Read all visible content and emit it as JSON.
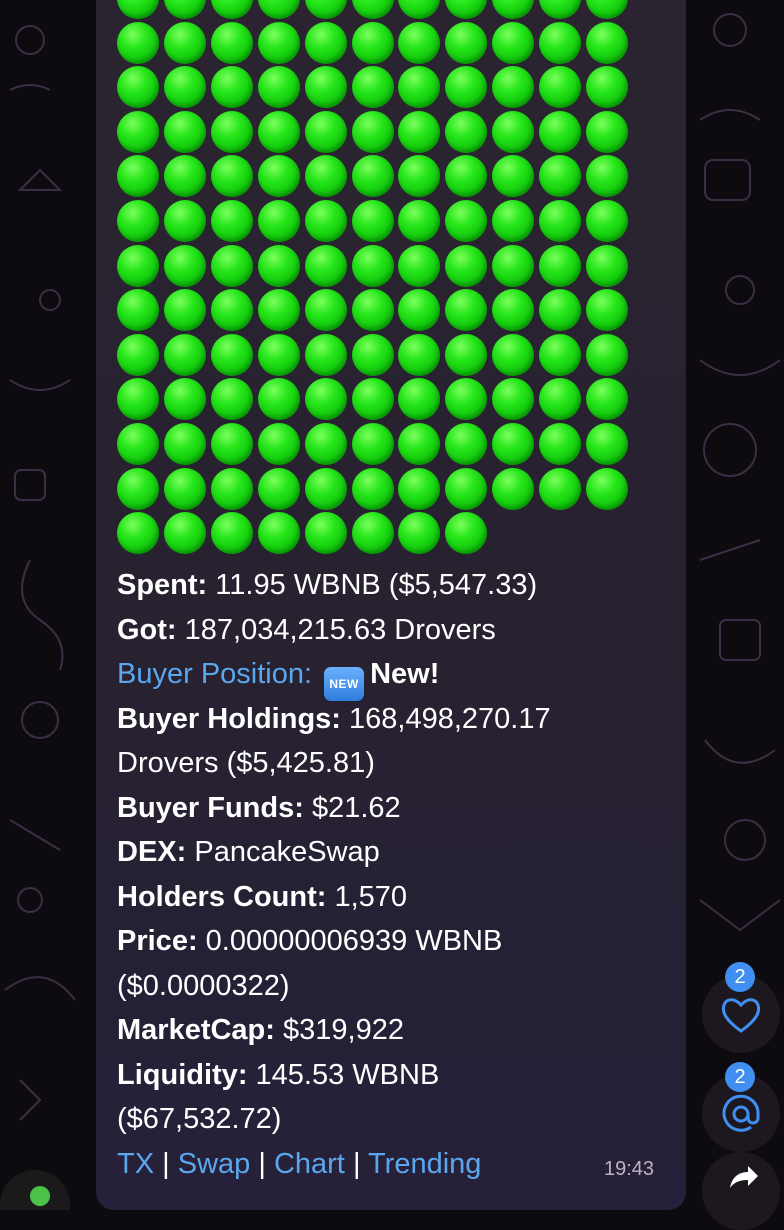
{
  "message": {
    "spent_label": "Spent:",
    "spent_value": " 11.95 WBNB ($5,547.33)",
    "got_label": "Got:",
    "got_value": " 187,034,215.63 Drovers",
    "buyer_position_link": "Buyer Position:",
    "new_badge": "NEW",
    "new_text": "New!",
    "holdings_label": "Buyer Holdings:",
    "holdings_value": " 168,498,270.17",
    "holdings_value_cont": "Drovers ($5,425.81)",
    "funds_label": "Buyer Funds:",
    "funds_value": " $21.62",
    "dex_label": "DEX:",
    "dex_value": " PancakeSwap",
    "holders_label": "Holders Count:",
    "holders_value": " 1,570",
    "price_label": "Price:",
    "price_value": " 0.00000006939 WBNB",
    "price_value_cont": "($0.0000322)",
    "marketcap_label": "MarketCap:",
    "marketcap_value": " $319,922",
    "liquidity_label": "Liquidity:",
    "liquidity_value": " 145.53 WBNB",
    "liquidity_value_cont": "($67,532.72)",
    "links": {
      "tx": "TX",
      "swap": "Swap",
      "chart": "Chart",
      "trending": "Trending",
      "separator": "|"
    },
    "time": "19:43"
  },
  "indicator": {
    "emoji": "green-circle",
    "rows": [
      11,
      11,
      11,
      11,
      11,
      11,
      11,
      11,
      11,
      11,
      11,
      11,
      8
    ]
  },
  "reactions": {
    "likes_count": "2",
    "mentions_count": "2",
    "heart_icon": "heart-icon",
    "mention_icon": "at-sign-icon",
    "share_icon": "share-arrow-icon"
  },
  "colors": {
    "bubble": "#2b2430",
    "link": "#5aa7ee",
    "badge": "#3f8ef0",
    "circle": "#1fd314"
  }
}
